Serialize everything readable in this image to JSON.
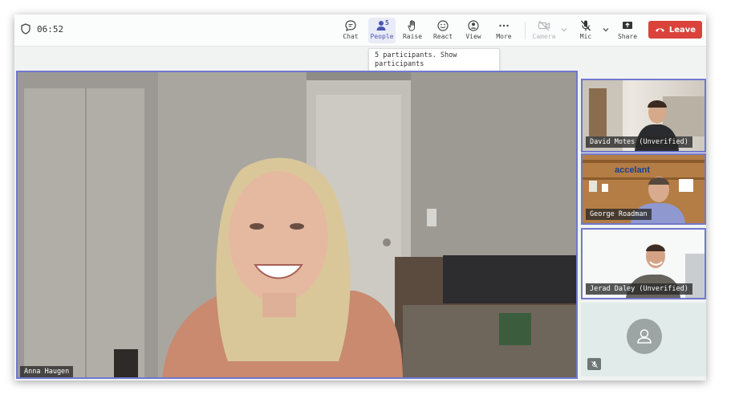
{
  "meeting": {
    "timer": "06:52"
  },
  "toolbar": {
    "chat_label": "Chat",
    "people_label": "People",
    "people_count": "5",
    "raise_label": "Raise",
    "react_label": "React",
    "view_label": "View",
    "more_label": "More",
    "camera_label": "Camera",
    "mic_label": "Mic",
    "share_label": "Share",
    "leave_label": "Leave"
  },
  "tooltip": {
    "text": "5 participants. Show participants"
  },
  "main": {
    "speaker_name": "Anna Haugen"
  },
  "tiles": [
    {
      "name": "David Motes (Unverified)"
    },
    {
      "name": "George Roadman"
    },
    {
      "name": "Jerad Daley (Unverified)"
    }
  ],
  "colors": {
    "accent": "#6f78cf",
    "leave": "#d9433b",
    "active": "#4a57b5"
  },
  "icons": [
    "shield-icon",
    "chat-icon",
    "people-icon",
    "raise-hand-icon",
    "react-icon",
    "view-icon",
    "more-icon",
    "camera-off-icon",
    "mic-off-icon",
    "share-icon",
    "phone-icon",
    "avatar-icon",
    "chevron-down-icon"
  ]
}
